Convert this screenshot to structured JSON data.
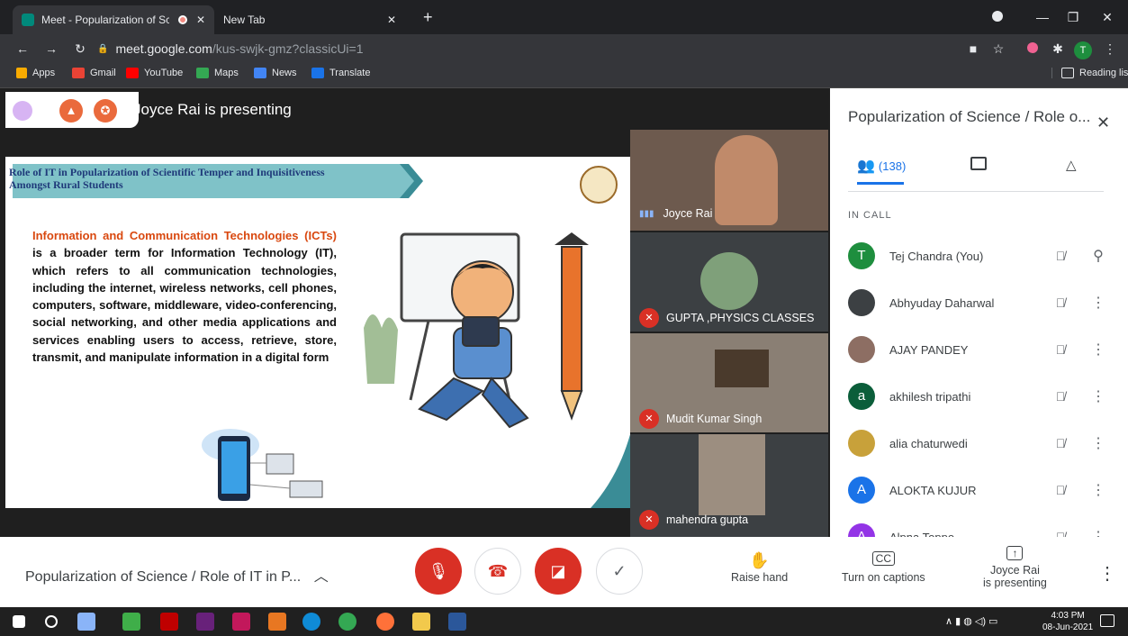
{
  "browser": {
    "tabs": [
      {
        "title": "Meet - Popularization of Scienc"
      },
      {
        "title": "New Tab"
      }
    ],
    "url_host": "meet.google.com",
    "url_path": "/kus-swjk-gmz?classicUi=1",
    "profile_initial": "T",
    "bookmarks": [
      "Apps",
      "Gmail",
      "YouTube",
      "Maps",
      "News",
      "Translate"
    ],
    "reading_list": "Reading list"
  },
  "meet": {
    "presenting_banner": "Joyce Rai is presenting",
    "slide": {
      "heading_line1": "Role of IT in Popularization of Scientific Temper and Inquisitiveness",
      "heading_line2": "Amongst Rural Students",
      "lead": "Information and Communication Technologies (ICTs)",
      "body": "is a broader term for Information Technology (IT), which refers to all communication technologies, including the internet, wireless networks, cell phones, computers, software, middleware, video-conferencing, social networking, and other media applications and services enabling users to access, retrieve, store, transmit, and manipulate information in a digital form"
    },
    "tiles": [
      {
        "name": "Joyce Rai"
      },
      {
        "name": "GUPTA ,PHYSICS CLASSES"
      },
      {
        "name": "Mudit Kumar Singh"
      },
      {
        "name": "mahendra gupta"
      }
    ],
    "panel": {
      "title": "Popularization of Science / Role o...",
      "people_count": "(138)",
      "in_call_label": "IN CALL",
      "participants": [
        {
          "name": "Tej Chandra (You)",
          "initial": "T",
          "color": "#1e8e3e"
        },
        {
          "name": "Abhyuday Daharwal",
          "initial": "",
          "color": "#3c4043"
        },
        {
          "name": "AJAY PANDEY",
          "initial": "",
          "color": "#8d6e63"
        },
        {
          "name": "akhilesh tripathi",
          "initial": "a",
          "color": "#0b5e3a"
        },
        {
          "name": "alia chaturwedi",
          "initial": "",
          "color": "#c8a13a"
        },
        {
          "name": "ALOKTA KUJUR",
          "initial": "A",
          "color": "#1a73e8"
        },
        {
          "name": "Alpna Toppo",
          "initial": "A",
          "color": "#9334e6"
        }
      ]
    },
    "bottom": {
      "meeting_title": "Popularization of Science / Role of IT in P...",
      "raise_hand": "Raise hand",
      "captions": "Turn on captions",
      "presenting_line1": "Joyce Rai",
      "presenting_line2": "is presenting"
    }
  },
  "taskbar": {
    "time": "4:03 PM",
    "date": "08-Jun-2021"
  },
  "colors": {
    "danger": "#d93025",
    "accent": "#1a73e8",
    "teal": "#3a8c96"
  }
}
